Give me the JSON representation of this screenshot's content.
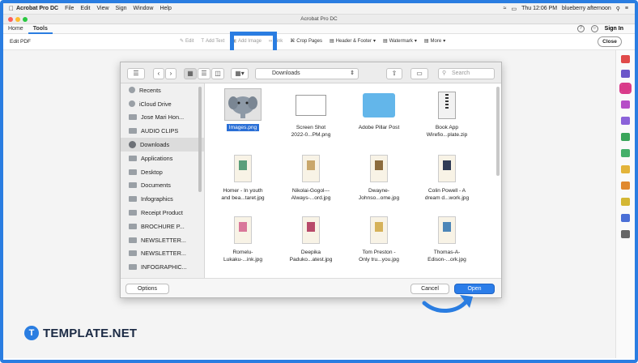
{
  "menubar": {
    "app": "Acrobat Pro DC",
    "items": [
      "File",
      "Edit",
      "View",
      "Sign",
      "Window",
      "Help"
    ],
    "clock": "Thu 12:06 PM",
    "user": "blueberry afternoon"
  },
  "window": {
    "title": "Acrobat Pro DC"
  },
  "tabs": {
    "home": "Home",
    "tools": "Tools",
    "sign_in": "Sign In"
  },
  "toolbar": {
    "title": "Edit PDF",
    "tools": [
      "Edit",
      "Add Text",
      "Add Image",
      "Link",
      "Crop Pages",
      "Header & Footer",
      "Watermark",
      "More"
    ],
    "close": "Close"
  },
  "dialog": {
    "location": "Downloads",
    "search_placeholder": "Search",
    "sidebar": [
      {
        "label": "Recents",
        "icon": "clock-icon"
      },
      {
        "label": "iCloud Drive",
        "icon": "cloud-icon"
      },
      {
        "label": "Jose Mari Hon...",
        "icon": "folder-icon"
      },
      {
        "label": "AUDIO CLIPS",
        "icon": "folder-icon"
      },
      {
        "label": "Downloads",
        "icon": "download-icon"
      },
      {
        "label": "Applications",
        "icon": "apps-icon"
      },
      {
        "label": "Desktop",
        "icon": "desktop-icon"
      },
      {
        "label": "Documents",
        "icon": "document-icon"
      },
      {
        "label": "Infographics",
        "icon": "folder-icon"
      },
      {
        "label": "Receipt Product",
        "icon": "folder-icon"
      },
      {
        "label": "BROCHURE P...",
        "icon": "folder-icon"
      },
      {
        "label": "NEWSLETTER...",
        "icon": "folder-icon"
      },
      {
        "label": "NEWSLETTER...",
        "icon": "folder-icon"
      },
      {
        "label": "INFOGRAPHIC...",
        "icon": "folder-icon"
      }
    ],
    "files": [
      {
        "line1": "Images.png",
        "line2": "",
        "type": "elephant",
        "selected": true
      },
      {
        "line1": "Screen Shot",
        "line2": "2022-0...PM.png",
        "type": "screenshot"
      },
      {
        "line1": "Adobe Pillar Post",
        "line2": "",
        "type": "folder"
      },
      {
        "line1": "Book App",
        "line2": "Wirefio...plate.zip",
        "type": "zip"
      },
      {
        "line1": "Homer - In youth",
        "line2": "and bea...taret.jpg",
        "type": "card",
        "color": "#5a9e7a"
      },
      {
        "line1": "Nikolai-Gogol---",
        "line2": "Always-...ord.jpg",
        "type": "card",
        "color": "#c9a76b"
      },
      {
        "line1": "Dwayne-",
        "line2": "Johnso...ome.jpg",
        "type": "card",
        "color": "#8c6c3e"
      },
      {
        "line1": "Colin Powell - A",
        "line2": "dream d...work.jpg",
        "type": "card",
        "color": "#2f3b55"
      },
      {
        "line1": "Romelu-",
        "line2": "Lukaku-...ink.jpg",
        "type": "card",
        "color": "#d9779a"
      },
      {
        "line1": "Deepika",
        "line2": "Paduko...atest.jpg",
        "type": "card",
        "color": "#b84a6a"
      },
      {
        "line1": "Tom Preston -",
        "line2": "Only tru...you.jpg",
        "type": "card",
        "color": "#d6b25a"
      },
      {
        "line1": "Thomas-A-",
        "line2": "Edison-...ork.jpg",
        "type": "card",
        "color": "#4d86b8"
      },
      {
        "line1": "",
        "line2": "",
        "type": "card",
        "color": "#8a6fa8"
      },
      {
        "line1": "",
        "line2": "",
        "type": "card",
        "color": "#7d8fc9"
      },
      {
        "line1": "",
        "line2": "",
        "type": "card",
        "color": "#c8b06a"
      },
      {
        "line1": "",
        "line2": "",
        "type": "card",
        "color": "#999999"
      }
    ],
    "options": "Options",
    "cancel": "Cancel",
    "open": "Open"
  },
  "brand": {
    "name": "TEMPLATE.NET",
    "mark": "T"
  },
  "colors": {
    "accent": "#2a7de1",
    "primary_button": "#2b7de9"
  }
}
